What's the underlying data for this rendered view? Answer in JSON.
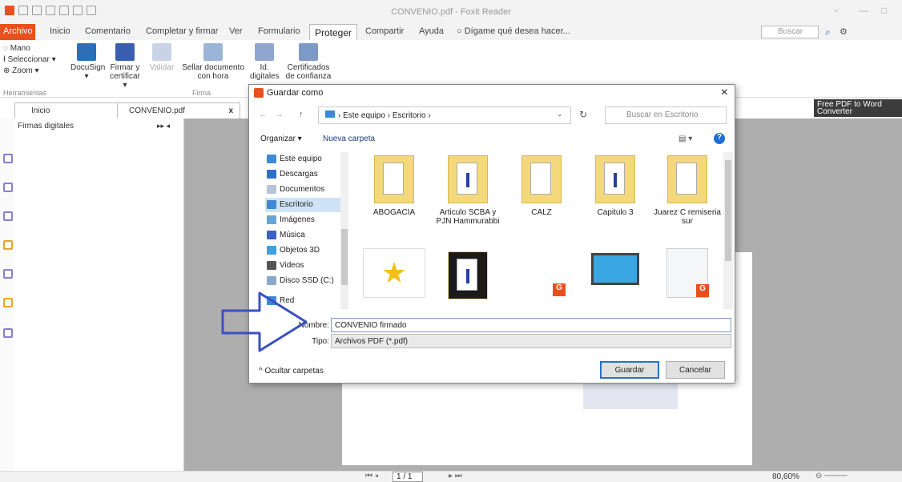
{
  "window": {
    "title": "CONVENIO.pdf - Foxit Reader"
  },
  "menu": {
    "items": [
      "Archivo",
      "Inicio",
      "Comentario",
      "Completar y firmar",
      "Ver",
      "Formulario",
      "Proteger",
      "Compartir",
      "Ayuda",
      "Dígame qué desea hacer..."
    ],
    "active": "Proteger",
    "search_placeholder": "Buscar"
  },
  "ribbon": {
    "tools": [
      "Mano",
      "Seleccionar",
      "Zoom"
    ],
    "tools_group": "Herramientas",
    "docusign": "DocuSign",
    "firmar_line1": "Firmar y",
    "firmar_line2": "certificar",
    "validar": "Validar",
    "sellar_line1": "Sellar documento",
    "sellar_line2": "con hora",
    "firma_group": "Firma",
    "ids_line1": "Id.",
    "ids_line2": "digitales",
    "certs_line1": "Certificados",
    "certs_line2": "de confianza"
  },
  "tabs": {
    "inicio": "Inicio",
    "doc": "CONVENIO.pdf",
    "close": "x"
  },
  "left_panel": {
    "title": "Firmas digitales"
  },
  "ad": {
    "line1": "Free PDF to Word",
    "line2": "Converter"
  },
  "dialog": {
    "title": "Guardar como",
    "path": [
      "Este equipo",
      "Escritorio"
    ],
    "search_placeholder": "Buscar en Escritorio",
    "organize": "Organizar",
    "new_folder": "Nueva carpeta",
    "tree": [
      {
        "label": "Este equipo",
        "color": "#3c8ad6"
      },
      {
        "label": "Descargas",
        "color": "#2d6fce"
      },
      {
        "label": "Documentos",
        "color": "#b8c4d8"
      },
      {
        "label": "Escritorio",
        "color": "#3c8ad6",
        "selected": true
      },
      {
        "label": "Imágenes",
        "color": "#6aa3d8"
      },
      {
        "label": "Música",
        "color": "#3b62c4"
      },
      {
        "label": "Objetos 3D",
        "color": "#3ea0e0"
      },
      {
        "label": "Videos",
        "color": "#555"
      },
      {
        "label": "Disco SSD (C:)",
        "color": "#8aa9c8"
      },
      {
        "label": "Red",
        "color": "#3c8ad6"
      }
    ],
    "files": [
      {
        "name": "ABOGACIA",
        "kind": "folder"
      },
      {
        "name": "Articulo SCBA y PJN Hammurabbi",
        "kind": "folder"
      },
      {
        "name": "CALZ",
        "kind": "folder"
      },
      {
        "name": "Capitulo 3",
        "kind": "folder"
      },
      {
        "name": "Juarez C remiseria sur",
        "kind": "folder"
      },
      {
        "name": "",
        "kind": "star"
      },
      {
        "name": "",
        "kind": "folder-dark"
      },
      {
        "name": "",
        "kind": "blank"
      },
      {
        "name": "",
        "kind": "computer"
      },
      {
        "name": "",
        "kind": "doc"
      }
    ],
    "nombre_label": "Nombre:",
    "nombre_value": "CONVENIO firmado",
    "tipo_label": "Tipo:",
    "tipo_value": "Archivos PDF (*.pdf)",
    "hide_folders": "Ocultar carpetas",
    "save": "Guardar",
    "cancel": "Cancelar"
  },
  "status": {
    "page": "1 / 1",
    "zoom": "80,60%"
  },
  "colors": {
    "accent": "#e8501d",
    "arrow": "#3a4fc4"
  }
}
